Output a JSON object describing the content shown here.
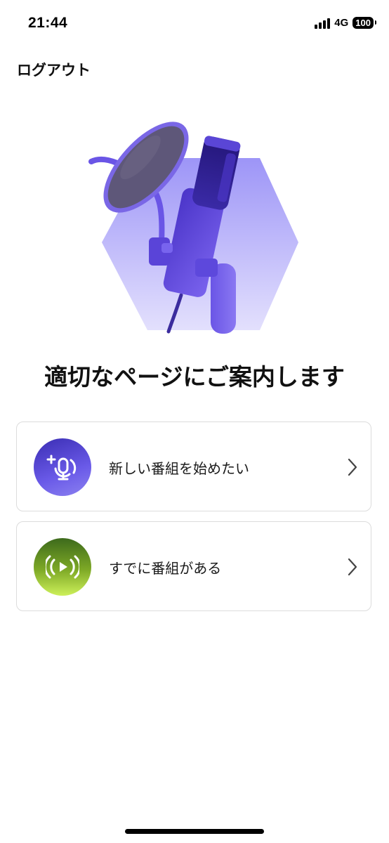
{
  "status_bar": {
    "time": "21:44",
    "network": "4G",
    "battery": "100"
  },
  "header": {
    "logout_label": "ログアウト"
  },
  "main": {
    "headline": "適切なページにご案内します",
    "options": [
      {
        "label": "新しい番組を始めたい",
        "icon": "add-microphone-icon"
      },
      {
        "label": "すでに番組がある",
        "icon": "broadcast-play-icon"
      }
    ]
  },
  "colors": {
    "primary_purple": "#5b4ae0",
    "accent_green": "#8cc22b",
    "card_border": "#dcdcdc"
  }
}
